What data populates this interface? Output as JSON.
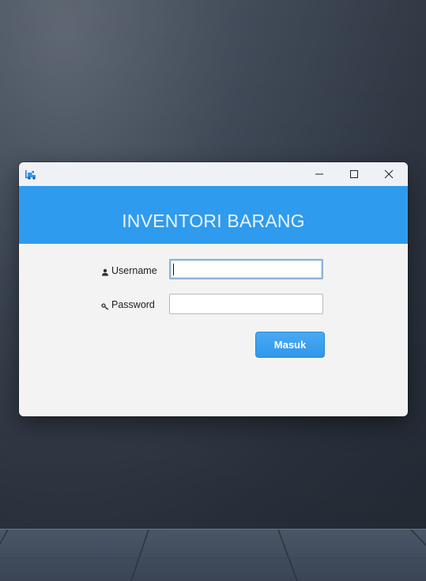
{
  "app": {
    "icon": "forklift-icon",
    "window_controls": {
      "minimize": "minimize-icon",
      "maximize": "maximize-icon",
      "close": "close-icon"
    }
  },
  "banner": {
    "title": "INVENTORI BARANG",
    "color": "#2f9bee"
  },
  "form": {
    "username_label": "Username",
    "username_icon": "user-icon",
    "username_value": "",
    "password_label": "Password",
    "password_icon": "key-icon",
    "password_value": "",
    "submit_label": "Masuk"
  },
  "colors": {
    "accent": "#2f9bee",
    "button": "#3aa0ee"
  }
}
